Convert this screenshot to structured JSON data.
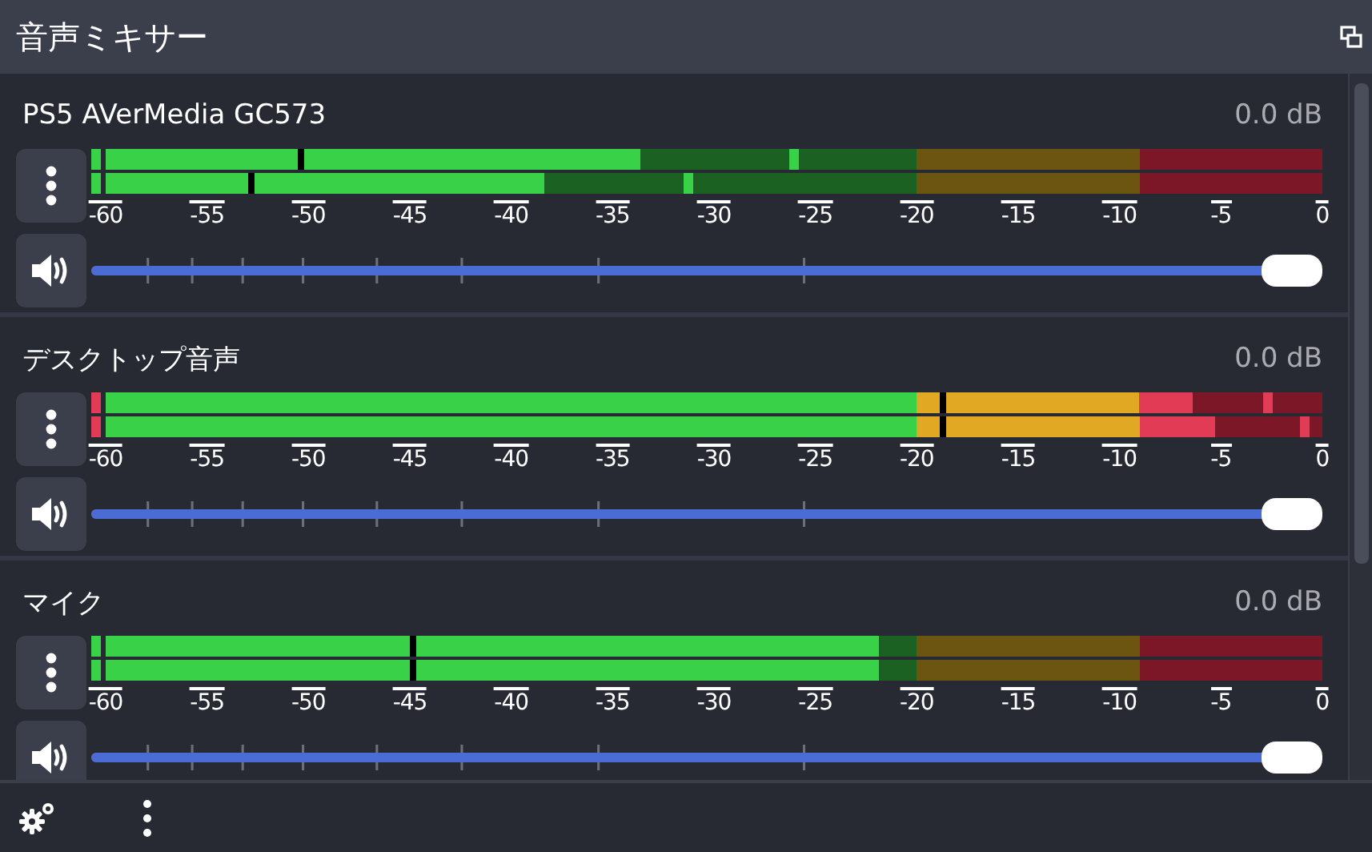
{
  "panel": {
    "title": "音声ミキサー"
  },
  "channels": [
    {
      "name": "PS5 AVerMedia GC573",
      "reading": "0.0 dB",
      "bars": [
        {
          "clipping": false,
          "level": 0.44,
          "magnitude": {
            "level": 0.16
          },
          "peak": {
            "level": 0.566
          }
        },
        {
          "clipping": false,
          "level": 0.36,
          "magnitude": {
            "level": 0.12
          },
          "peak": {
            "level": 0.479
          }
        }
      ],
      "scale": [
        "-60",
        "-55",
        "-50",
        "-45",
        "-40",
        "-35",
        "-30",
        "-25",
        "-20",
        "-15",
        "-10",
        "-5",
        "0"
      ],
      "volume": {
        "level": 1
      }
    },
    {
      "name": "デスクトップ音声",
      "reading": "0.0 dB",
      "bars": [
        {
          "clipping": true,
          "level": 0.894,
          "magnitude": {
            "level": 0.688
          },
          "peak": {
            "level": 0.955
          }
        },
        {
          "clipping": true,
          "level": 0.912,
          "magnitude": {
            "level": 0.688
          },
          "peak": {
            "level": 0.985
          }
        }
      ],
      "scale": [
        "-60",
        "-55",
        "-50",
        "-45",
        "-40",
        "-35",
        "-30",
        "-25",
        "-20",
        "-15",
        "-10",
        "-5",
        "0"
      ],
      "volume": {
        "level": 1
      }
    },
    {
      "name": "マイク",
      "reading": "0.0 dB",
      "bars": [
        {
          "clipping": false,
          "level": 0.635,
          "magnitude": {
            "level": 0.253
          }
        },
        {
          "clipping": false,
          "level": 0.635,
          "magnitude": {
            "level": 0.253
          }
        }
      ],
      "scale": [
        "-60",
        "-55",
        "-50",
        "-45",
        "-40",
        "-35",
        "-30",
        "-25",
        "-20",
        "-15",
        "-10",
        "-5",
        "0"
      ],
      "volume": {
        "level": 1
      }
    }
  ]
}
